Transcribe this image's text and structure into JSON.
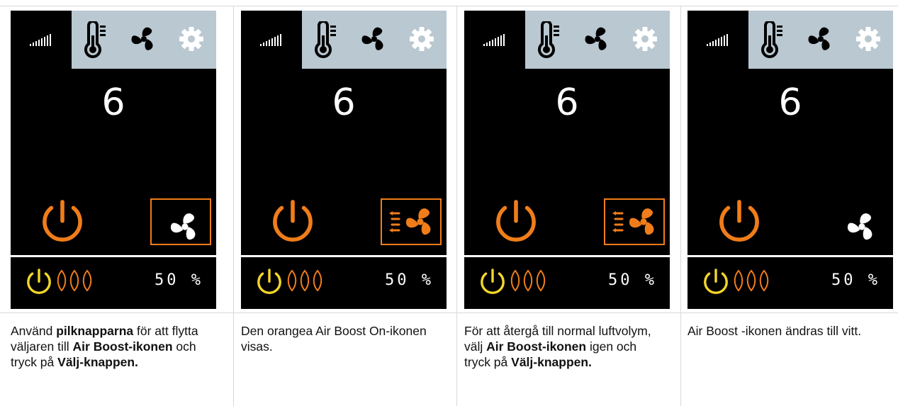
{
  "colors": {
    "orange": "#f07d1a",
    "yellow": "#f4d62a",
    "topbar": "#b9c8d1",
    "screen": "#000000"
  },
  "icons": [
    "signal-bars-icon",
    "thermometer-icon",
    "fan-icon",
    "gear-icon",
    "power-icon",
    "leaf-icon",
    "air-boost-icon"
  ],
  "panels": [
    {
      "level": "6",
      "percent": "50 %",
      "boost_state": "white-fan-selected",
      "caption": {
        "t1": "Använd ",
        "b1": "pilknapparna",
        "t2": " för att flytta väljaren till ",
        "b2": "Air Boost-ikonen",
        "t3": " och tryck på ",
        "b3": "Välj-knappen."
      }
    },
    {
      "level": "6",
      "percent": "50 %",
      "boost_state": "orange-boost-selected",
      "caption": {
        "t1": "Den orangea Air Boost On-ikonen visas."
      }
    },
    {
      "level": "6",
      "percent": "50 %",
      "boost_state": "orange-boost-selected",
      "caption": {
        "t1": "För att återgå till normal luftvolym, välj ",
        "b1": "Air Boost-ikonen",
        "t2": " igen och tryck på ",
        "b2": "Välj-knappen."
      }
    },
    {
      "level": "6",
      "percent": "50 %",
      "boost_state": "white-fan",
      "caption": {
        "t1": "Air Boost -ikonen ändras till vitt."
      }
    }
  ]
}
